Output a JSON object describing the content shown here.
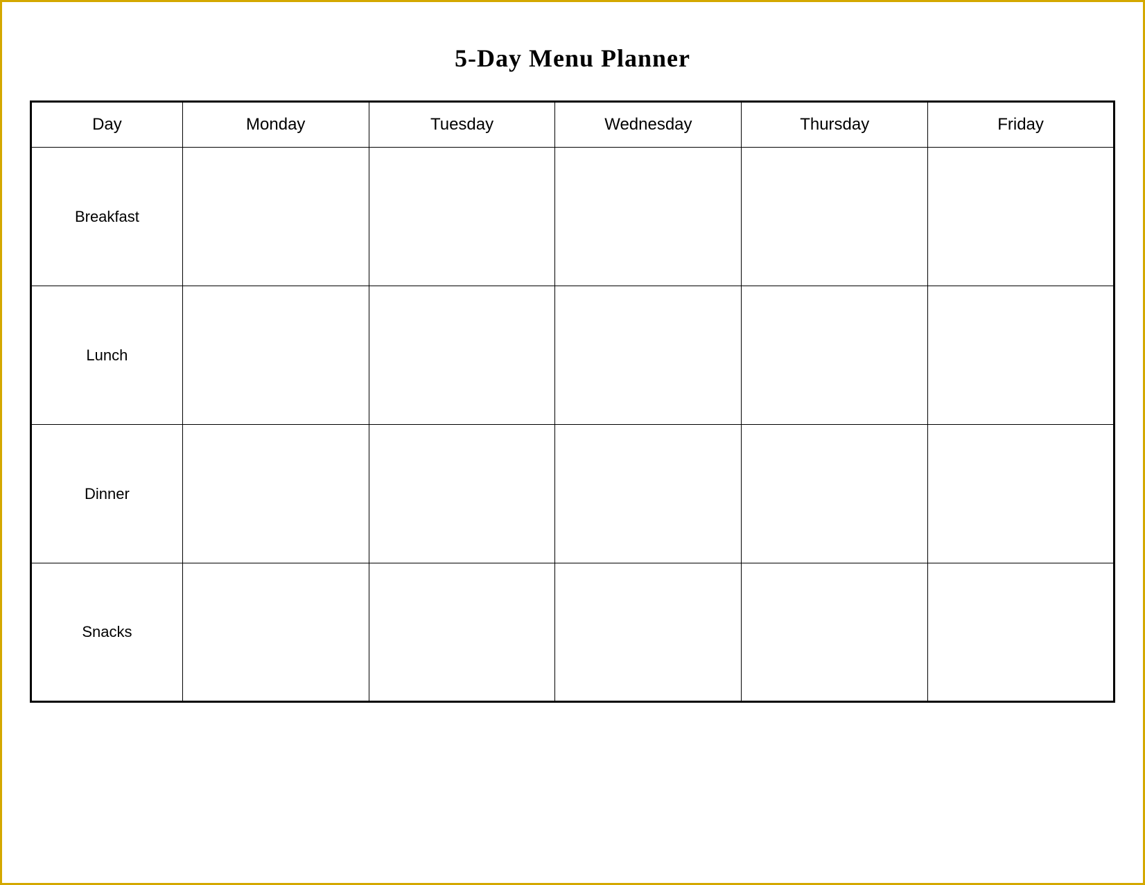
{
  "title": "5-Day Menu Planner",
  "table": {
    "headers": [
      {
        "key": "day",
        "label": "Day"
      },
      {
        "key": "monday",
        "label": "Monday"
      },
      {
        "key": "tuesday",
        "label": "Tuesday"
      },
      {
        "key": "wednesday",
        "label": "Wednesday"
      },
      {
        "key": "thursday",
        "label": "Thursday"
      },
      {
        "key": "friday",
        "label": "Friday"
      }
    ],
    "rows": [
      {
        "label": "Breakfast"
      },
      {
        "label": "Lunch"
      },
      {
        "label": "Dinner"
      },
      {
        "label": "Snacks"
      }
    ]
  }
}
